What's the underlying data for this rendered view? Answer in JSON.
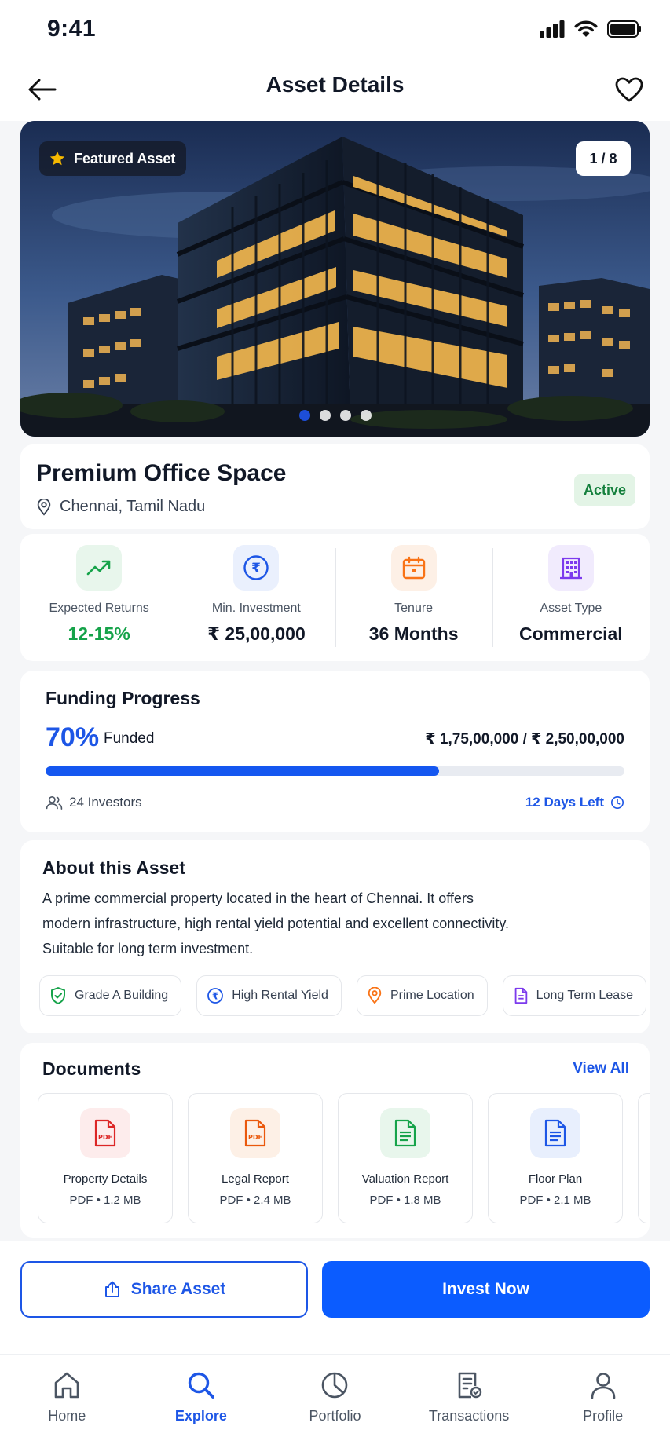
{
  "status_bar": {
    "time": "9:41"
  },
  "header": {
    "title": "Asset Details"
  },
  "hero": {
    "featured_label": "Featured Asset",
    "counter": "1 / 8",
    "slide_count": 4,
    "active_slide": 1
  },
  "asset": {
    "name": "Premium Office Space",
    "location": "Chennai, Tamil Nadu",
    "status": "Active"
  },
  "stats": [
    {
      "label": "Expected Returns",
      "value": "12-15%",
      "icon": "trending-up-icon",
      "color": "#16a34a"
    },
    {
      "label": "Min. Investment",
      "value": "₹ 25,00,000",
      "icon": "rupee-icon",
      "color": "#1d56e6"
    },
    {
      "label": "Tenure",
      "value": "36 Months",
      "icon": "calendar-icon",
      "color": "#f97316"
    },
    {
      "label": "Asset Type",
      "value": "Commercial",
      "icon": "building-icon",
      "color": "#7c3aed"
    }
  ],
  "funding": {
    "title": "Funding Progress",
    "percent_label": "70%",
    "funded_label": "Funded",
    "amount": "₹ 1,75,00,000 / ₹ 2,50,00,000",
    "progress_fraction": 0.68,
    "investors": "24 Investors",
    "days_left": "12 Days Left"
  },
  "about": {
    "title": "About this Asset",
    "lines": [
      "A prime commercial property located in the heart of Chennai. It offers",
      "modern infrastructure, high rental yield potential and excellent connectivity.",
      "Suitable for long term investment."
    ],
    "tags": [
      {
        "label": "Grade A Building",
        "icon": "shield-check-icon",
        "color": "#16a34a"
      },
      {
        "label": "High Rental Yield",
        "icon": "rupee-icon",
        "color": "#1d56e6"
      },
      {
        "label": "Prime Location",
        "icon": "location-pin-icon",
        "color": "#f97316"
      },
      {
        "label": "Long Term Lease",
        "icon": "document-icon",
        "color": "#7c3aed"
      }
    ]
  },
  "documents": {
    "title": "Documents",
    "view_all": "View All",
    "items": [
      {
        "name": "Property Details",
        "meta": "PDF • 1.2 MB",
        "icon": "pdf-icon",
        "color": "#dc2626",
        "bg": "#fdecec"
      },
      {
        "name": "Legal Report",
        "meta": "PDF • 2.4 MB",
        "icon": "pdf-icon",
        "color": "#ea580c",
        "bg": "#fdf0e6"
      },
      {
        "name": "Valuation Report",
        "meta": "PDF • 1.8 MB",
        "icon": "document-icon",
        "color": "#16a34a",
        "bg": "#e8f6ec"
      },
      {
        "name": "Floor Plan",
        "meta": "PDF • 2.1 MB",
        "icon": "document-icon",
        "color": "#1d56e6",
        "bg": "#e8effd"
      }
    ]
  },
  "actions": {
    "share": "Share Asset",
    "invest": "Invest Now"
  },
  "nav": [
    {
      "label": "Home",
      "icon": "home-icon",
      "active": false
    },
    {
      "label": "Explore",
      "icon": "search-icon",
      "active": true
    },
    {
      "label": "Portfolio",
      "icon": "pie-chart-icon",
      "active": false
    },
    {
      "label": "Transactions",
      "icon": "receipt-icon",
      "active": false
    },
    {
      "label": "Profile",
      "icon": "user-icon",
      "active": false
    }
  ]
}
